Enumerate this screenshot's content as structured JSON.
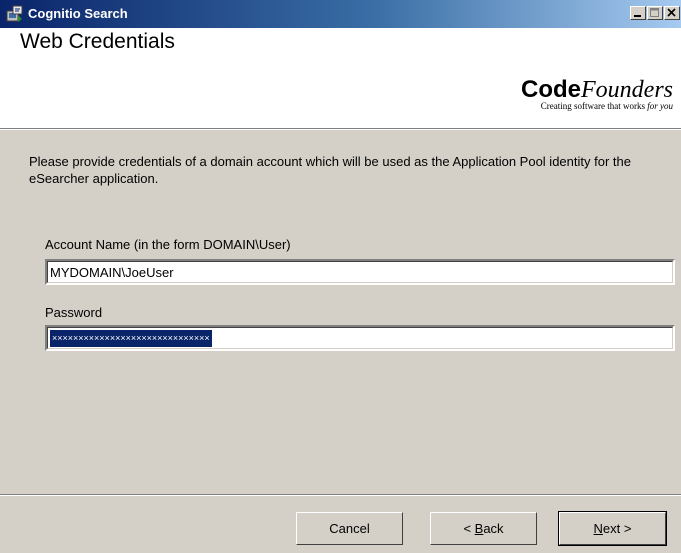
{
  "window": {
    "title": "Cognitio Search",
    "icon": "installer-icon",
    "controls": {
      "minimize": "minimize-icon",
      "maximize": "maximize-icon",
      "close": "close-icon"
    }
  },
  "header": {
    "title": "Web Credentials",
    "logo": {
      "name_bold": "Code",
      "name_italic": "Founders",
      "tagline_main": "Creating software that works ",
      "tagline_italic": "for you"
    }
  },
  "body": {
    "description": "Please provide credentials of a domain account which will be used as the Application Pool identity for the eSearcher application.",
    "account": {
      "label": "Account Name (in the form DOMAIN\\User)",
      "value": "MYDOMAIN\\JoeUser"
    },
    "password": {
      "label": "Password",
      "value": "××××××××××××××××××××××××××××××"
    }
  },
  "footer": {
    "cancel_label": "Cancel",
    "back_prefix": "< ",
    "back_key": "B",
    "back_rest": "ack",
    "next_key": "N",
    "next_rest": "ext >"
  }
}
